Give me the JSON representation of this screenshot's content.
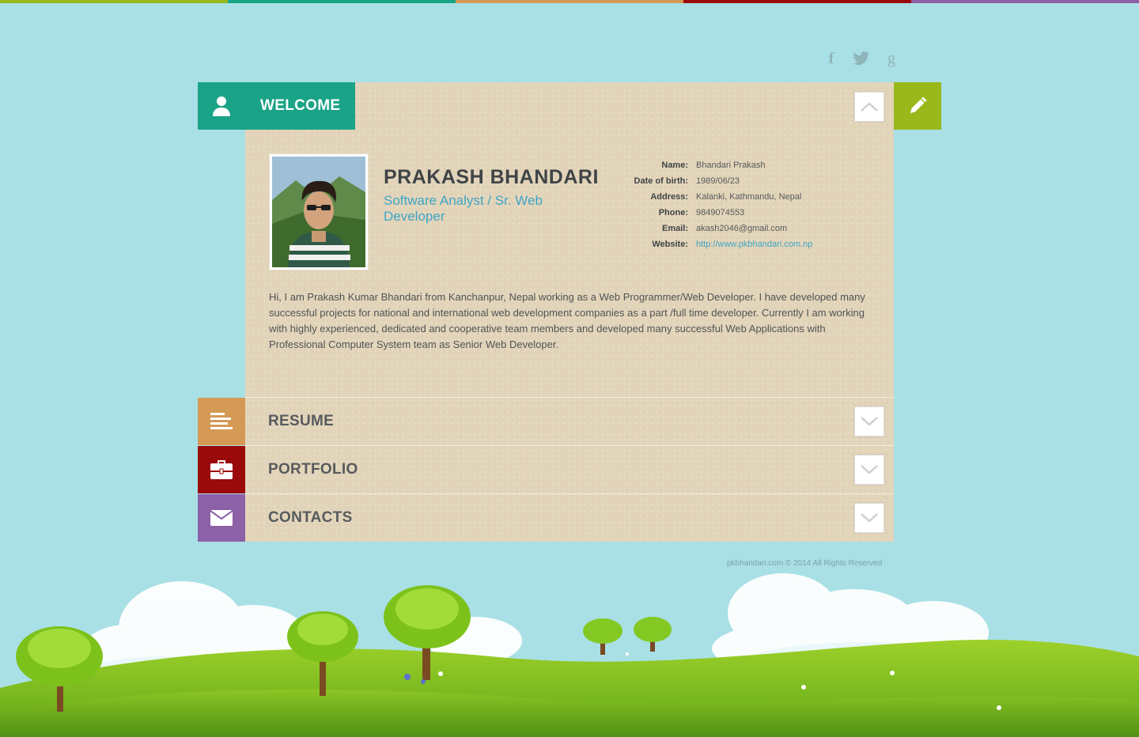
{
  "colors": {
    "topbar": [
      "#9ab81c",
      "#1aa386",
      "#d49a55",
      "#9a0a0a",
      "#8d61a8"
    ],
    "welcome": "#1aa386",
    "edit": "#9ab81c",
    "resume": "#d49a55",
    "portfolio": "#9a0a0a",
    "contacts": "#8d61a8"
  },
  "social": {
    "facebook": "f",
    "twitter": "t",
    "google": "g"
  },
  "welcome": {
    "title": "WELCOME",
    "icon": "user-icon"
  },
  "profile": {
    "name": "PRAKASH BHANDARI",
    "role": "Software Analyst / Sr. Web Developer",
    "info": [
      {
        "label": "Name:",
        "value": "Bhandari Prakash"
      },
      {
        "label": "Date of birth:",
        "value": "1989/06/23"
      },
      {
        "label": "Address:",
        "value": "Kalanki, Kathmandu, Nepal"
      },
      {
        "label": "Phone:",
        "value": "9849074553"
      },
      {
        "label": "Email:",
        "value": "akash2046@gmail.com"
      },
      {
        "label": "Website:",
        "value": "http://www.pkbhandari.com.np"
      }
    ],
    "bio": "Hi, I am Prakash Kumar Bhandari from Kanchanpur, Nepal working as a Web Programmer/Web Developer. I have developed many successful projects for national and international web development companies as a part /full time developer. Currently I am working with highly experienced, dedicated and cooperative team members and developed many successful Web Applications with Professional Computer System team as Senior Web Developer."
  },
  "sections": [
    {
      "label": "RESUME",
      "icon": "align-left-icon"
    },
    {
      "label": "PORTFOLIO",
      "icon": "briefcase-icon"
    },
    {
      "label": "CONTACTS",
      "icon": "envelope-icon"
    }
  ],
  "footer": "pkbhandari.com © 2014 All Rights Reserved"
}
